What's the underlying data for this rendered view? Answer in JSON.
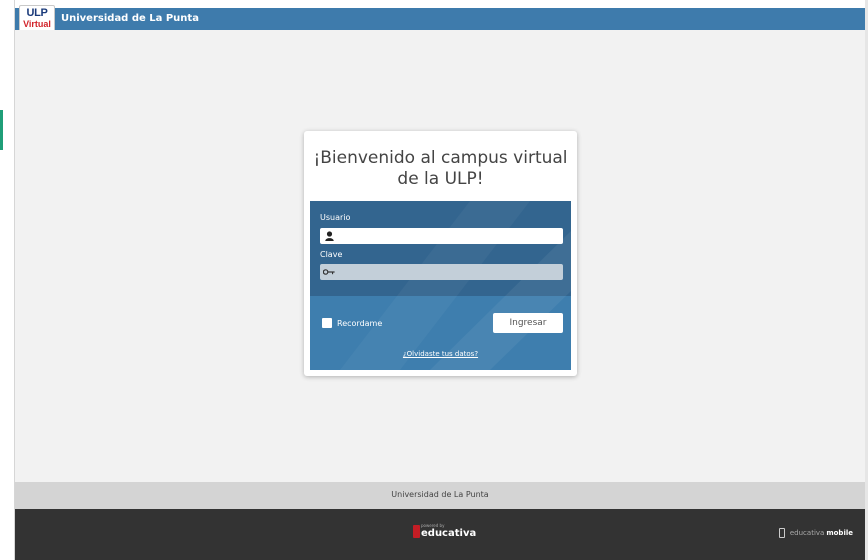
{
  "header": {
    "logo_top": "ULP",
    "logo_bottom": "Virtual",
    "title": "Universidad de La Punta",
    "color": "#3e7bac"
  },
  "login": {
    "heading": "¡Bienvenido al campus virtual de la ULP!",
    "user_label": "Usuario",
    "user_value": "",
    "user_icon": "user-icon",
    "password_label": "Clave",
    "password_value": "",
    "password_icon": "key-icon",
    "remember_label": "Recordame",
    "remember_checked": false,
    "submit_label": "Ingresar",
    "forgot_link": "¿Olvidaste tus datos?",
    "panel_colors": [
      "#33658f",
      "#3e7eae"
    ]
  },
  "footer": {
    "institution": "Universidad de La Punta",
    "powered_by": "powered by",
    "brand": "educativa",
    "mobile_name": "educativa",
    "mobile_suffix": "mobile",
    "mobile_icon": "phone-icon"
  }
}
